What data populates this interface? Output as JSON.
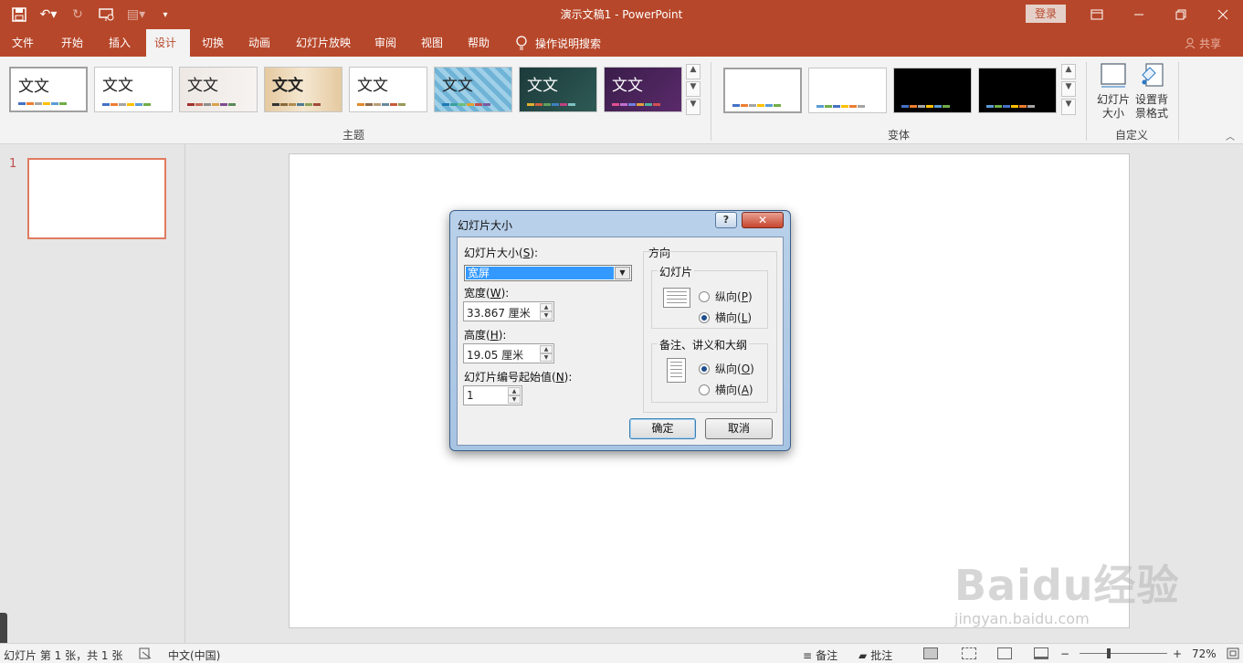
{
  "window": {
    "title": "演示文稿1  -  PowerPoint",
    "login_label": "登录"
  },
  "tabs": [
    "文件",
    "开始",
    "插入",
    "设计",
    "切换",
    "动画",
    "幻灯片放映",
    "审阅",
    "视图",
    "帮助"
  ],
  "tell_me": "操作说明搜索",
  "share_label": "共享",
  "ribbon": {
    "themes": {
      "label": "主题",
      "thumb_text": "文文"
    },
    "variants": {
      "label": "变体"
    },
    "customize": {
      "label": "自定义",
      "slide_size": [
        "幻灯片",
        "大小"
      ],
      "bg_format": [
        "设置背",
        "景格式"
      ]
    }
  },
  "thumbnail": {
    "number": "1"
  },
  "dialog": {
    "title": "幻灯片大小",
    "help": "?",
    "close": "✕",
    "size_label": "幻灯片大小(",
    "size_key": "S",
    "size_value": "宽屏",
    "width_label": "宽度(",
    "width_key": "W",
    "width_value": "33.867 厘米",
    "height_label": "高度(",
    "height_key": "H",
    "height_value": "19.05 厘米",
    "start_label": "幻灯片编号起始值(",
    "start_key": "N",
    "start_value": "1",
    "orientation_label": "方向",
    "slides_group": "幻灯片",
    "slide_portrait": "纵向(",
    "slide_portrait_key": "P",
    "slide_landscape": "横向(",
    "slide_landscape_key": "L",
    "notes_group": "备注、讲义和大纲",
    "notes_portrait": "纵向(",
    "notes_portrait_key": "O",
    "notes_landscape": "横向(",
    "notes_landscape_key": "A",
    "ok": "确定",
    "cancel": "取消"
  },
  "status": {
    "slide_info": "幻灯片 第 1 张，共 1 张",
    "language": "中文(中国)",
    "notes": "备注",
    "comments": "批注",
    "zoom": "72%"
  },
  "watermark": {
    "brand": "Baidu经验",
    "url": "jingyan.baidu.com"
  }
}
